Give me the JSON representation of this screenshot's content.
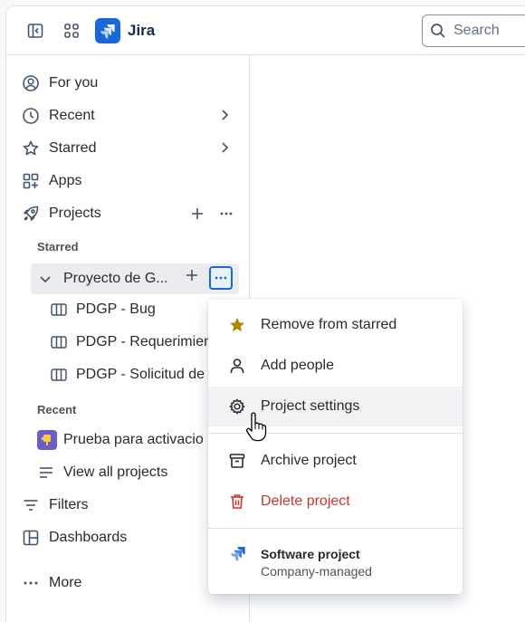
{
  "app": {
    "name": "Jira",
    "brand_color": "#1868db"
  },
  "search": {
    "placeholder": "Search"
  },
  "sidebar": {
    "items": [
      {
        "label": "For you",
        "icon": "user-circle-icon"
      },
      {
        "label": "Recent",
        "icon": "clock-icon"
      },
      {
        "label": "Starred",
        "icon": "star-icon"
      },
      {
        "label": "Apps",
        "icon": "apps-icon"
      },
      {
        "label": "Projects",
        "icon": "rocket-icon"
      }
    ],
    "starred_label": "Starred",
    "starred_project": "Proyecto de G...",
    "boards": [
      {
        "label": "PDGP - Bug"
      },
      {
        "label": "PDGP - Requerimien"
      },
      {
        "label": "PDGP - Solicitud de"
      }
    ],
    "recent_label": "Recent",
    "recent_project": "Prueba para activacio",
    "view_all": "View all projects",
    "filters": "Filters",
    "dashboards": "Dashboards",
    "more": "More"
  },
  "menu": {
    "items": [
      {
        "label": "Remove from starred",
        "icon": "star-filled-icon"
      },
      {
        "label": "Add people",
        "icon": "person-icon"
      },
      {
        "label": "Project settings",
        "icon": "gear-icon"
      },
      {
        "label": "Archive project",
        "icon": "archive-icon"
      },
      {
        "label": "Delete project",
        "icon": "trash-icon"
      }
    ],
    "footer_title": "Software project",
    "footer_subtitle": "Company-managed"
  },
  "colors": {
    "star": "#b38600",
    "danger": "#c9372c",
    "accent": "#1868db"
  }
}
